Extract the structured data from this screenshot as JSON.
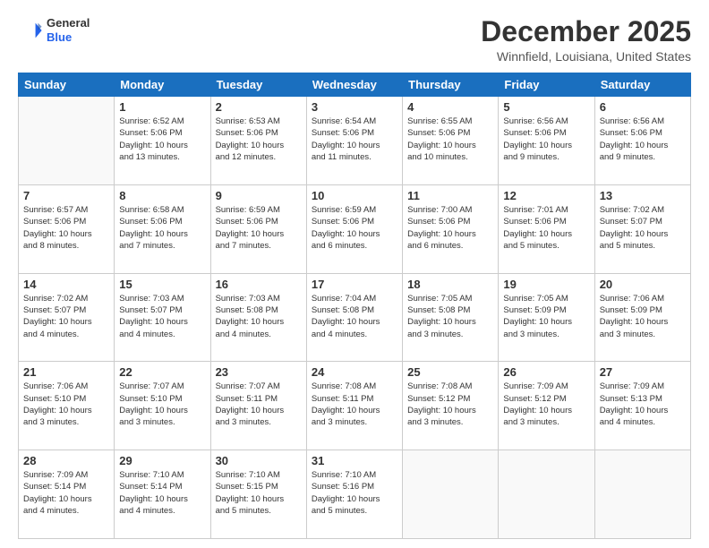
{
  "app": {
    "logo_general": "General",
    "logo_blue": "Blue"
  },
  "header": {
    "month": "December 2025",
    "location": "Winnfield, Louisiana, United States"
  },
  "weekdays": [
    "Sunday",
    "Monday",
    "Tuesday",
    "Wednesday",
    "Thursday",
    "Friday",
    "Saturday"
  ],
  "weeks": [
    [
      {
        "day": "",
        "info": ""
      },
      {
        "day": "1",
        "info": "Sunrise: 6:52 AM\nSunset: 5:06 PM\nDaylight: 10 hours\nand 13 minutes."
      },
      {
        "day": "2",
        "info": "Sunrise: 6:53 AM\nSunset: 5:06 PM\nDaylight: 10 hours\nand 12 minutes."
      },
      {
        "day": "3",
        "info": "Sunrise: 6:54 AM\nSunset: 5:06 PM\nDaylight: 10 hours\nand 11 minutes."
      },
      {
        "day": "4",
        "info": "Sunrise: 6:55 AM\nSunset: 5:06 PM\nDaylight: 10 hours\nand 10 minutes."
      },
      {
        "day": "5",
        "info": "Sunrise: 6:56 AM\nSunset: 5:06 PM\nDaylight: 10 hours\nand 9 minutes."
      },
      {
        "day": "6",
        "info": "Sunrise: 6:56 AM\nSunset: 5:06 PM\nDaylight: 10 hours\nand 9 minutes."
      }
    ],
    [
      {
        "day": "7",
        "info": "Sunrise: 6:57 AM\nSunset: 5:06 PM\nDaylight: 10 hours\nand 8 minutes."
      },
      {
        "day": "8",
        "info": "Sunrise: 6:58 AM\nSunset: 5:06 PM\nDaylight: 10 hours\nand 7 minutes."
      },
      {
        "day": "9",
        "info": "Sunrise: 6:59 AM\nSunset: 5:06 PM\nDaylight: 10 hours\nand 7 minutes."
      },
      {
        "day": "10",
        "info": "Sunrise: 6:59 AM\nSunset: 5:06 PM\nDaylight: 10 hours\nand 6 minutes."
      },
      {
        "day": "11",
        "info": "Sunrise: 7:00 AM\nSunset: 5:06 PM\nDaylight: 10 hours\nand 6 minutes."
      },
      {
        "day": "12",
        "info": "Sunrise: 7:01 AM\nSunset: 5:06 PM\nDaylight: 10 hours\nand 5 minutes."
      },
      {
        "day": "13",
        "info": "Sunrise: 7:02 AM\nSunset: 5:07 PM\nDaylight: 10 hours\nand 5 minutes."
      }
    ],
    [
      {
        "day": "14",
        "info": "Sunrise: 7:02 AM\nSunset: 5:07 PM\nDaylight: 10 hours\nand 4 minutes."
      },
      {
        "day": "15",
        "info": "Sunrise: 7:03 AM\nSunset: 5:07 PM\nDaylight: 10 hours\nand 4 minutes."
      },
      {
        "day": "16",
        "info": "Sunrise: 7:03 AM\nSunset: 5:08 PM\nDaylight: 10 hours\nand 4 minutes."
      },
      {
        "day": "17",
        "info": "Sunrise: 7:04 AM\nSunset: 5:08 PM\nDaylight: 10 hours\nand 4 minutes."
      },
      {
        "day": "18",
        "info": "Sunrise: 7:05 AM\nSunset: 5:08 PM\nDaylight: 10 hours\nand 3 minutes."
      },
      {
        "day": "19",
        "info": "Sunrise: 7:05 AM\nSunset: 5:09 PM\nDaylight: 10 hours\nand 3 minutes."
      },
      {
        "day": "20",
        "info": "Sunrise: 7:06 AM\nSunset: 5:09 PM\nDaylight: 10 hours\nand 3 minutes."
      }
    ],
    [
      {
        "day": "21",
        "info": "Sunrise: 7:06 AM\nSunset: 5:10 PM\nDaylight: 10 hours\nand 3 minutes."
      },
      {
        "day": "22",
        "info": "Sunrise: 7:07 AM\nSunset: 5:10 PM\nDaylight: 10 hours\nand 3 minutes."
      },
      {
        "day": "23",
        "info": "Sunrise: 7:07 AM\nSunset: 5:11 PM\nDaylight: 10 hours\nand 3 minutes."
      },
      {
        "day": "24",
        "info": "Sunrise: 7:08 AM\nSunset: 5:11 PM\nDaylight: 10 hours\nand 3 minutes."
      },
      {
        "day": "25",
        "info": "Sunrise: 7:08 AM\nSunset: 5:12 PM\nDaylight: 10 hours\nand 3 minutes."
      },
      {
        "day": "26",
        "info": "Sunrise: 7:09 AM\nSunset: 5:12 PM\nDaylight: 10 hours\nand 3 minutes."
      },
      {
        "day": "27",
        "info": "Sunrise: 7:09 AM\nSunset: 5:13 PM\nDaylight: 10 hours\nand 4 minutes."
      }
    ],
    [
      {
        "day": "28",
        "info": "Sunrise: 7:09 AM\nSunset: 5:14 PM\nDaylight: 10 hours\nand 4 minutes."
      },
      {
        "day": "29",
        "info": "Sunrise: 7:10 AM\nSunset: 5:14 PM\nDaylight: 10 hours\nand 4 minutes."
      },
      {
        "day": "30",
        "info": "Sunrise: 7:10 AM\nSunset: 5:15 PM\nDaylight: 10 hours\nand 5 minutes."
      },
      {
        "day": "31",
        "info": "Sunrise: 7:10 AM\nSunset: 5:16 PM\nDaylight: 10 hours\nand 5 minutes."
      },
      {
        "day": "",
        "info": ""
      },
      {
        "day": "",
        "info": ""
      },
      {
        "day": "",
        "info": ""
      }
    ]
  ]
}
